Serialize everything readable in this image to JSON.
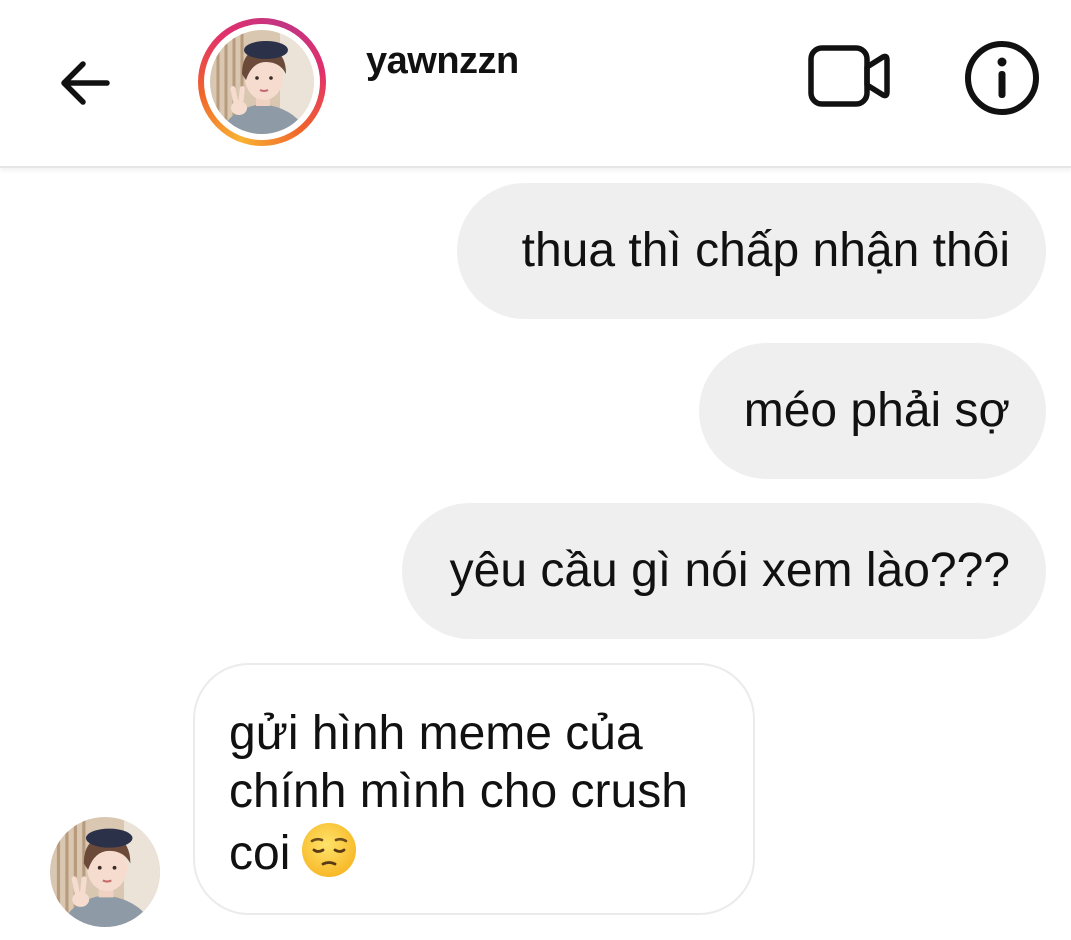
{
  "header": {
    "back_icon": "arrow-left-icon",
    "username": "yawnzzn",
    "video_call_icon": "video-camera-icon",
    "info_icon": "info-circle-icon",
    "story_ring_colors": [
      "#f9b233",
      "#f0632b",
      "#e1306c",
      "#c13584"
    ]
  },
  "messages": [
    {
      "direction": "outgoing",
      "text": "thua thì chấp nhận thôi"
    },
    {
      "direction": "outgoing",
      "text": "méo phải sợ"
    },
    {
      "direction": "outgoing",
      "text": "yêu cầu gì nói xem lào???"
    },
    {
      "direction": "incoming",
      "lines": [
        "gửi hình meme của",
        "chính mình cho crush",
        "coi"
      ],
      "emoji": "pensive-face-emoji"
    }
  ],
  "colors": {
    "outgoing_bubble": "#efefef",
    "incoming_bubble_border": "#ebebeb",
    "text": "#111111"
  }
}
